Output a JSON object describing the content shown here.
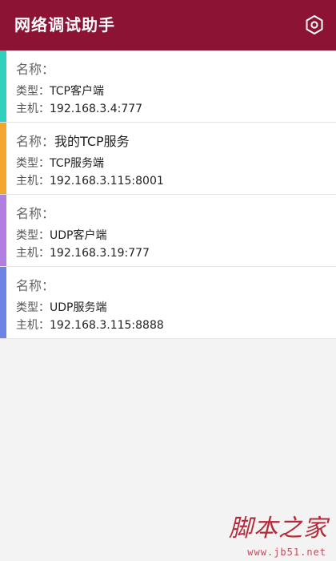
{
  "app": {
    "title": "网络调试助手",
    "bar_color": "#8d1335",
    "settings_icon": "settings-hexagon-icon"
  },
  "connections": [
    {
      "name_label": "名称：",
      "name_value": "",
      "type_label": "类型：",
      "type_value": "TCP客户端",
      "host_label": "主机：",
      "host_value": "192.168.3.4:777",
      "color": "#2fd1bc"
    },
    {
      "name_label": "名称：",
      "name_value": "我的TCP服务",
      "type_label": "类型：",
      "type_value": "TCP服务端",
      "host_label": "主机：",
      "host_value": "192.168.3.115:8001",
      "color": "#f3a530"
    },
    {
      "name_label": "名称：",
      "name_value": "",
      "type_label": "类型：",
      "type_value": "UDP客户端",
      "host_label": "主机：",
      "host_value": "192.168.3.19:777",
      "color": "#b27ee2"
    },
    {
      "name_label": "名称：",
      "name_value": "",
      "type_label": "类型：",
      "type_value": "UDP服务端",
      "host_label": "主机：",
      "host_value": "192.168.3.115:8888",
      "color": "#6f82e6"
    }
  ],
  "watermark": {
    "text": "脚本之家",
    "url": "www.jb51.net"
  }
}
